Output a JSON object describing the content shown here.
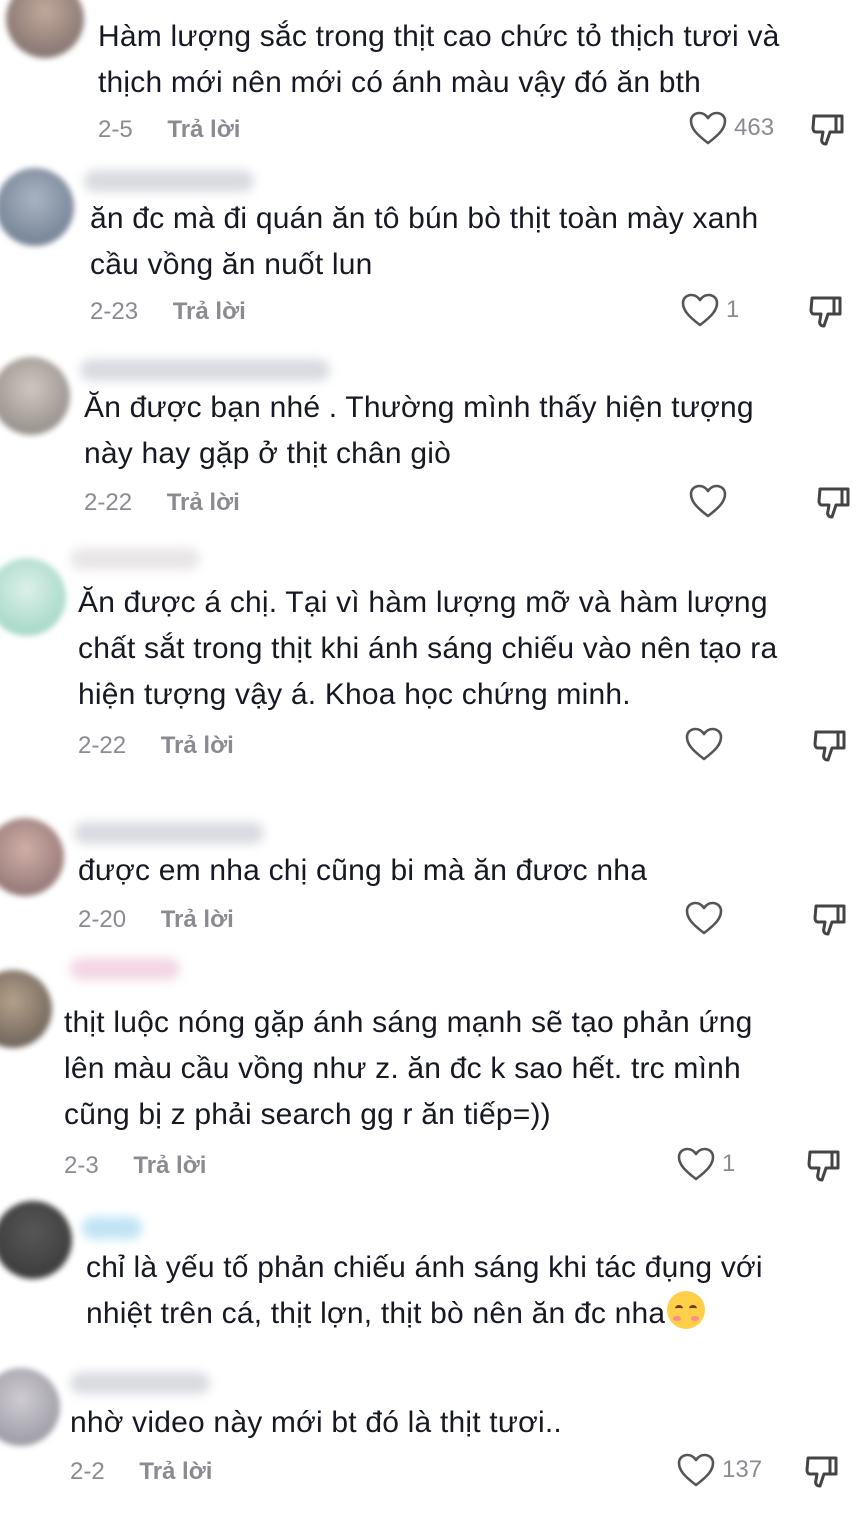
{
  "comments": [
    {
      "text": "Hàm lượng sắc trong thịt cao chức tỏ thịch tươi và\nthịch mới nên mới có ánh màu vậy đó ăn bth",
      "date": "2-5",
      "reply": "Trả lời",
      "likes": "463"
    },
    {
      "text": "ăn đc mà đi quán ăn tô bún bò thịt toàn mày xanh\ncầu vồng ăn nuốt lun",
      "date": "2-23",
      "reply": "Trả lời",
      "likes": "1"
    },
    {
      "text": "Ăn được bạn nhé . Thường mình thấy hiện tượng\nnày hay gặp ở thịt chân giò",
      "date": "2-22",
      "reply": "Trả lời",
      "likes": ""
    },
    {
      "text": "Ăn được á chị. Tại vì hàm lượng mỡ và hàm lượng\nchất sắt trong thịt khi ánh sáng chiếu vào nên tạo ra\nhiện tượng vậy á. Khoa học chứng minh.",
      "date": "2-22",
      "reply": "Trả lời",
      "likes": ""
    },
    {
      "text": "được em nha chị cũng bi mà ăn đươc nha",
      "date": "2-20",
      "reply": "Trả lời",
      "likes": ""
    },
    {
      "text": "thịt luộc nóng gặp ánh sáng mạnh sẽ tạo phản ứng\nlên màu cầu vồng như z. ăn đc k sao hết. trc mình\ncũng bị z phải search gg r ăn tiếp=))",
      "date": "2-3",
      "reply": "Trả lời",
      "likes": "1"
    },
    {
      "text": "chỉ là yếu tố phản chiếu ánh sáng khi tác đụng với\nnhiệt trên cá, thịt lợn, thịt bò nên ăn đc nha",
      "emoji": "smiling-face-with-hearts"
    },
    {
      "text": "nhờ video này mới bt đó là thịt tươi..",
      "date": "2-2",
      "reply": "Trả lời",
      "likes": "137"
    }
  ],
  "colors": {
    "text": "#161823",
    "meta": "#8a8b91"
  }
}
